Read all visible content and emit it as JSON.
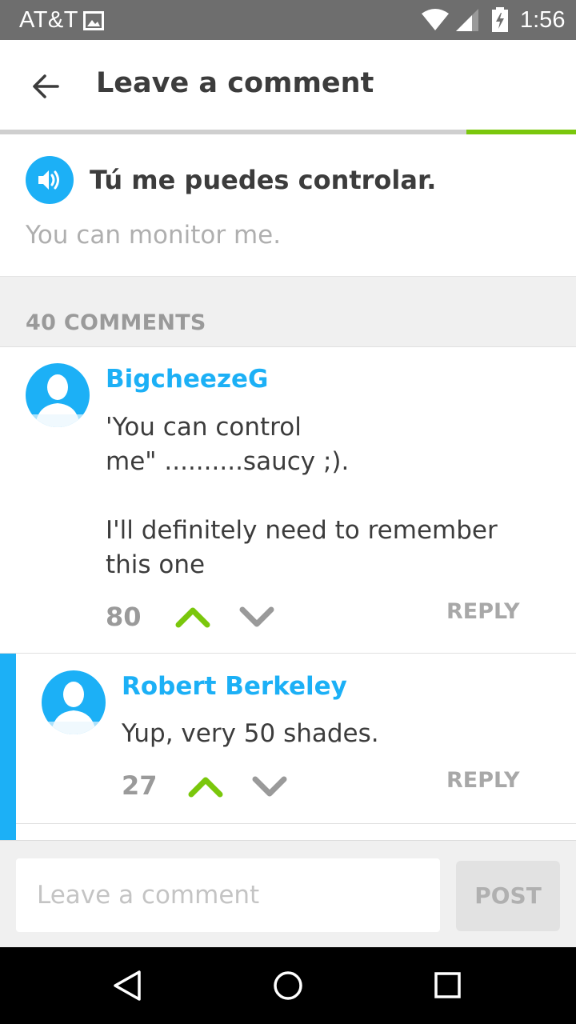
{
  "status_bar": {
    "carrier": "AT&T",
    "time": "1:56",
    "icons": [
      "image-notification-icon",
      "wifi-icon",
      "cell-signal-icon",
      "battery-charging-icon"
    ]
  },
  "app_bar": {
    "title": "Leave a comment",
    "back_icon": "arrow-left-icon"
  },
  "lesson_progress": {
    "fraction": 0.19,
    "color": "#7ac70c"
  },
  "sentence": {
    "text": "Tú me puedes controlar.",
    "translation": "You can monitor me.",
    "audio_icon": "speaker-icon"
  },
  "comments": {
    "count_label": "40 COMMENTS",
    "items": [
      {
        "author": "BigcheezeG",
        "body": "'You can control\nme\" ..........saucy ;).\n\nI'll definitely need to remember\nthis one",
        "votes": "80",
        "reply_label": "REPLY"
      },
      {
        "author": "Robert Berkeley",
        "body": "Yup, very 50 shades.",
        "votes": "27",
        "reply_label": "REPLY"
      }
    ]
  },
  "composer": {
    "placeholder": "Leave a comment",
    "value": "",
    "post_label": "POST"
  },
  "nav_bar": {
    "icons": [
      "nav-back-icon",
      "nav-home-icon",
      "nav-recents-icon"
    ]
  },
  "colors": {
    "accent_blue": "#1cb0f6",
    "upvote_green": "#7ac70c",
    "status_bar": "#6e6e6e",
    "muted_text": "#9a9a9a"
  }
}
